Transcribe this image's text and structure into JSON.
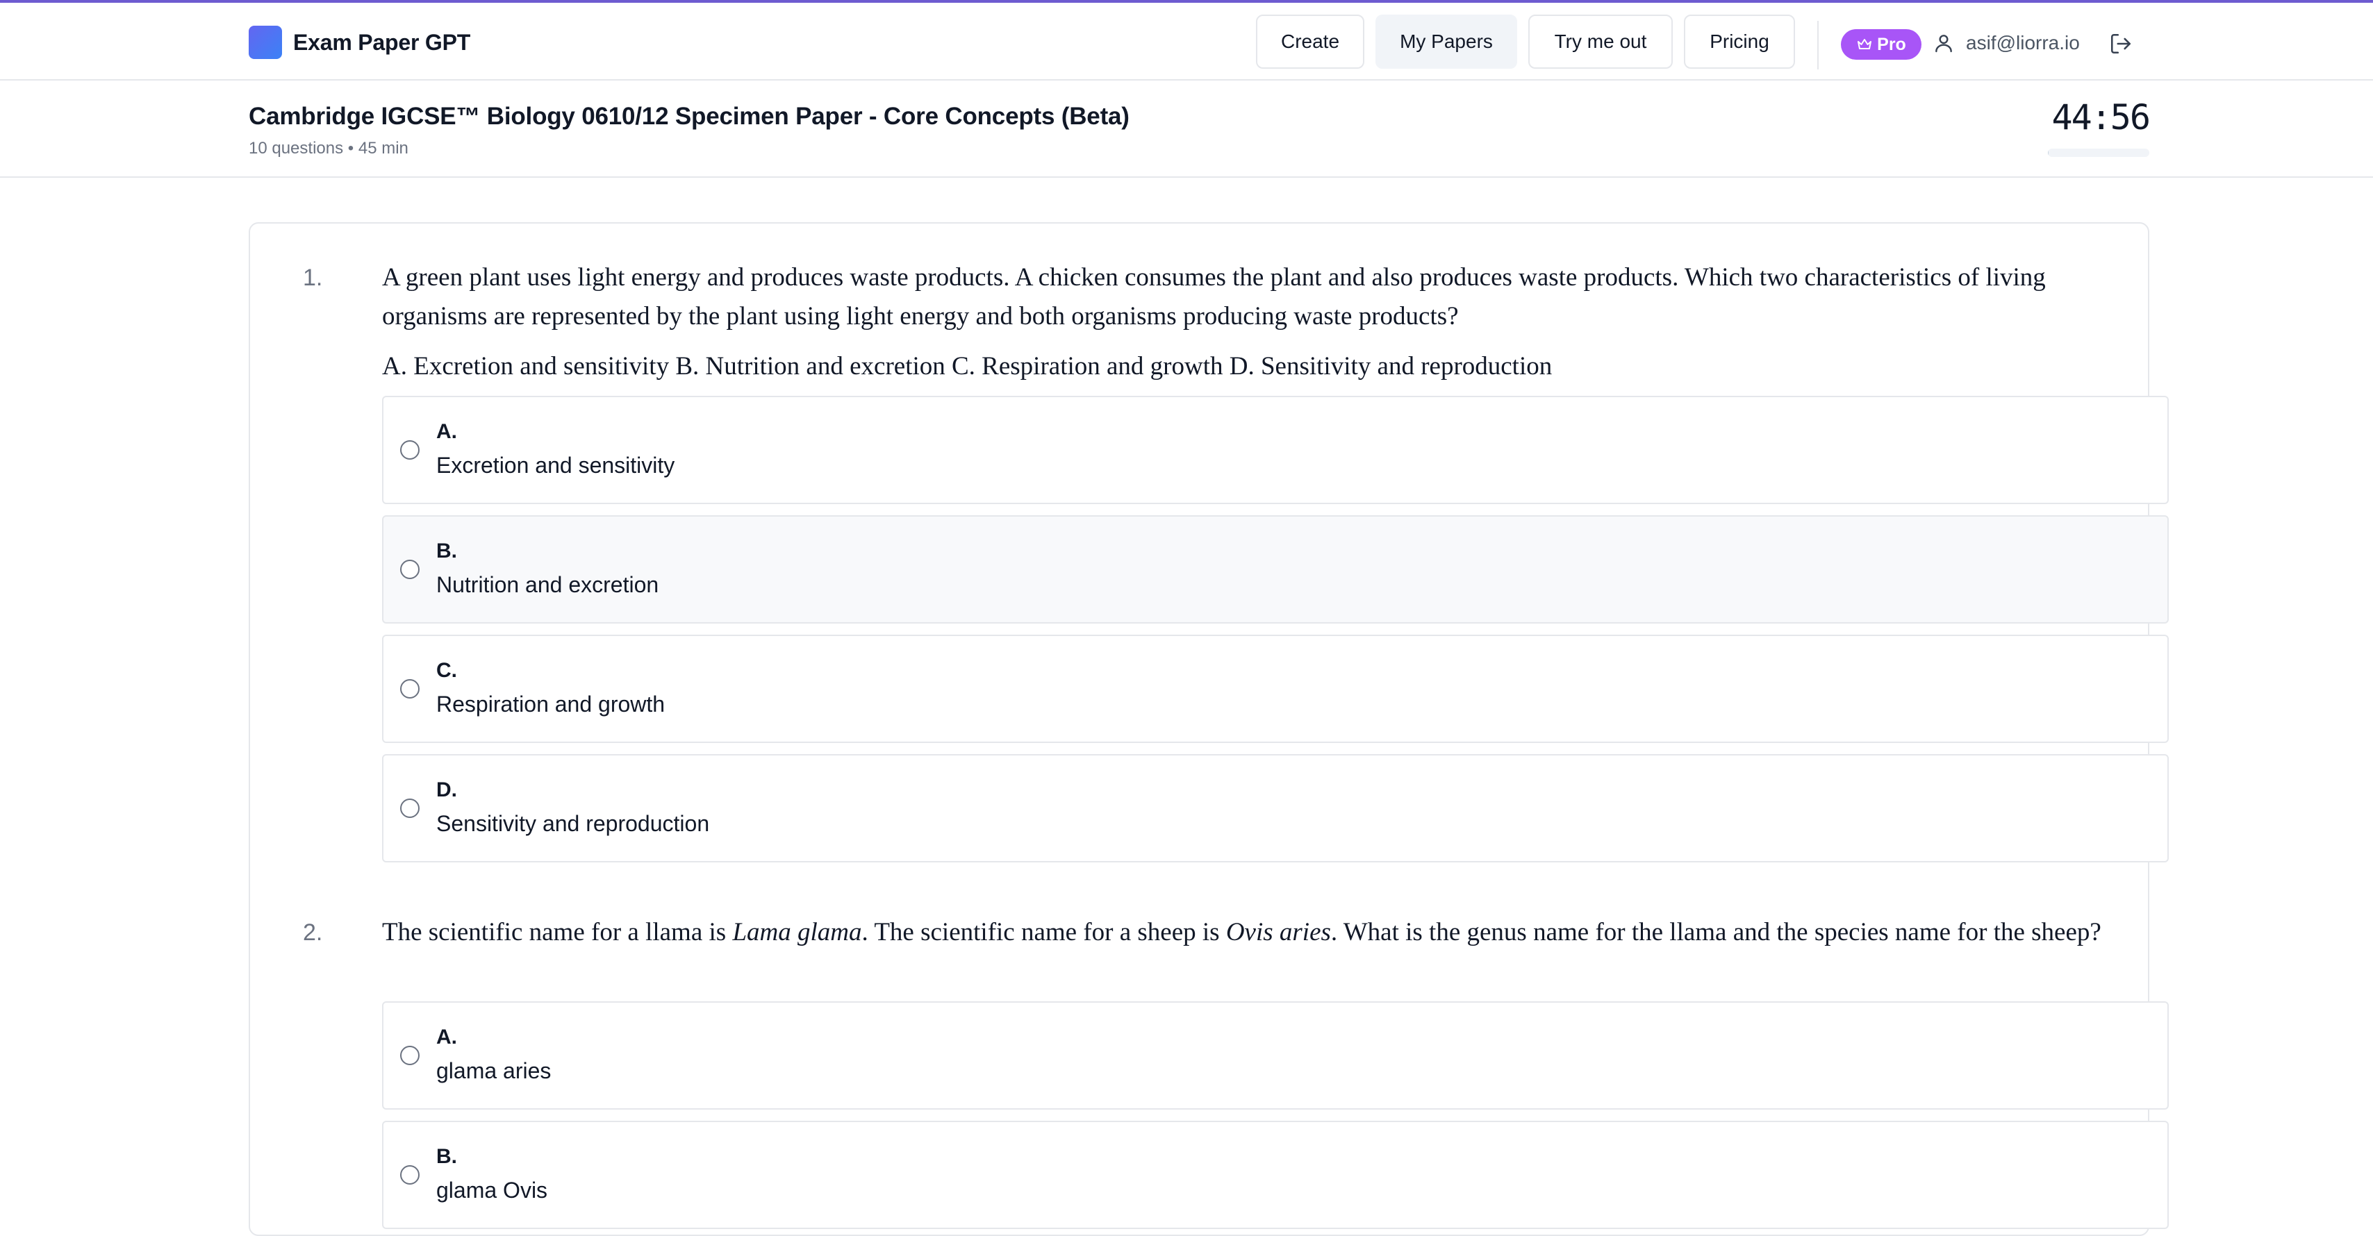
{
  "app": {
    "name": "Exam Paper GPT",
    "accent": "#6d5bd0"
  },
  "nav": {
    "buttons": [
      {
        "label": "Create",
        "active": false
      },
      {
        "label": "My Papers",
        "active": true
      },
      {
        "label": "Try me out",
        "active": false
      },
      {
        "label": "Pricing",
        "active": false
      }
    ],
    "badge": "Pro",
    "badge_color": "#a855f7",
    "user_email": "asif@liorra.io"
  },
  "paper": {
    "title": "Cambridge IGCSE™ Biology 0610/12 Specimen Paper - Core Concepts (Beta)",
    "meta": "10 questions • 45 min",
    "timer": "44:56",
    "timer_progress": 0.01
  },
  "questions": [
    {
      "number": "1.",
      "text": "A green plant uses light energy and produces waste products. A chicken consumes the plant and also produces waste products. Which two characteristics of living organisms are represented by the plant using light energy and both organisms producing waste products?",
      "inline_options": "A. Excretion and sensitivity B. Nutrition and excretion C. Respiration and growth D. Sensitivity and reproduction",
      "options": [
        {
          "letter": "A.",
          "text": "Excretion and sensitivity"
        },
        {
          "letter": "B.",
          "text": "Nutrition and excretion"
        },
        {
          "letter": "C.",
          "text": "Respiration and growth"
        },
        {
          "letter": "D.",
          "text": "Sensitivity and reproduction"
        }
      ]
    },
    {
      "number": "2.",
      "text_parts": {
        "p1": "The scientific name for a llama is ",
        "i1": "Lama glama",
        "p2": ". The scientific name for a sheep is ",
        "i2": "Ovis aries",
        "p3": ". What is the genus name for the llama and the species name for the sheep?"
      },
      "options": [
        {
          "letter": "A.",
          "text": "glama aries"
        },
        {
          "letter": "B.",
          "text": "glama Ovis"
        }
      ]
    }
  ]
}
